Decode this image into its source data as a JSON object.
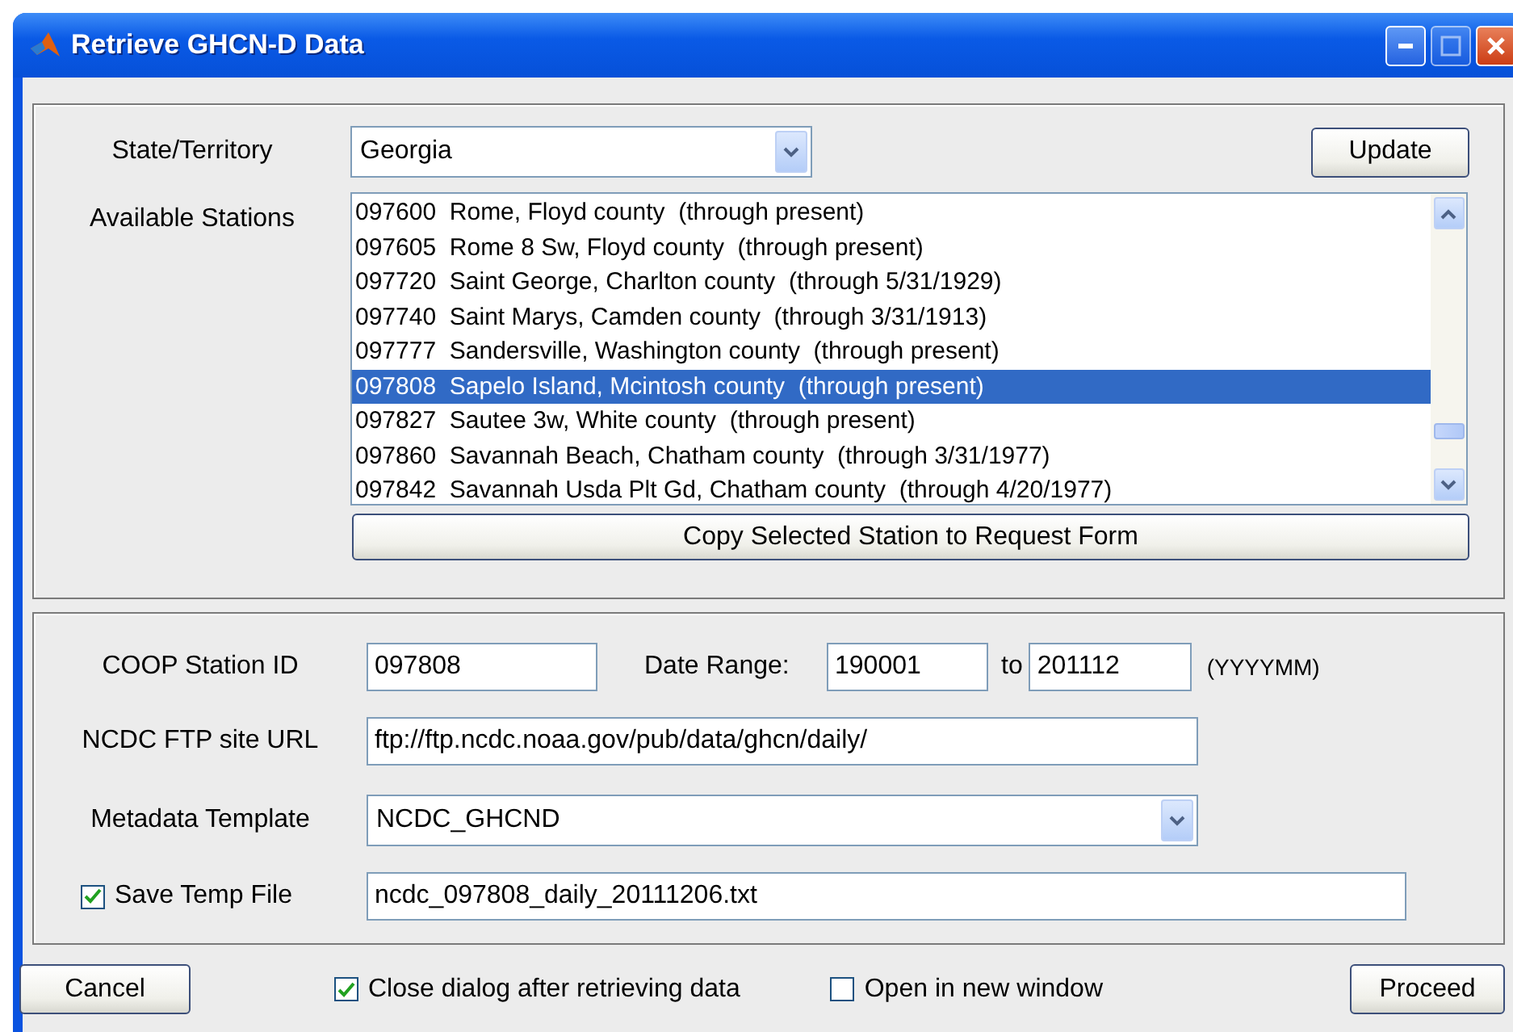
{
  "window": {
    "title": "Retrieve GHCN-D Data"
  },
  "station_panel": {
    "state_label": "State/Territory",
    "state_value": "Georgia",
    "update_button": "Update",
    "stations_label": "Available Stations",
    "stations": [
      {
        "text": "097600  Rome, Floyd county  (through present)",
        "selected": false
      },
      {
        "text": "097605  Rome 8 Sw, Floyd county  (through present)",
        "selected": false
      },
      {
        "text": "097720  Saint George, Charlton county  (through 5/31/1929)",
        "selected": false
      },
      {
        "text": "097740  Saint Marys, Camden county  (through 3/31/1913)",
        "selected": false
      },
      {
        "text": "097777  Sandersville, Washington county  (through present)",
        "selected": false
      },
      {
        "text": "097808  Sapelo Island, Mcintosh county  (through present)",
        "selected": true
      },
      {
        "text": "097827  Sautee 3w, White county  (through present)",
        "selected": false
      },
      {
        "text": "097860  Savannah Beach, Chatham county  (through 3/31/1977)",
        "selected": false
      },
      {
        "text": "097842  Savannah Usda Plt Gd, Chatham county  (through 4/20/1977)",
        "selected": false
      }
    ],
    "copy_button": "Copy Selected Station to Request Form"
  },
  "request_panel": {
    "station_id_label": "COOP Station ID",
    "station_id": "097808",
    "date_range_label": "Date Range:",
    "date_from": "190001",
    "to_label": "to",
    "date_to": "201112",
    "date_format": "(YYYYMM)",
    "url_label": "NCDC FTP site URL",
    "url": "ftp://ftp.ncdc.noaa.gov/pub/data/ghcn/daily/",
    "template_label": "Metadata Template",
    "template": "NCDC_GHCND",
    "save_temp": {
      "label": "Save Temp File",
      "checked": true
    },
    "temp_file": "ncdc_097808_daily_20111206.txt"
  },
  "footer": {
    "cancel_button": "Cancel",
    "close_after": {
      "label": "Close dialog after retrieving data",
      "checked": true
    },
    "open_new_window": {
      "label": "Open in new window",
      "checked": false
    },
    "proceed_button": "Proceed"
  }
}
